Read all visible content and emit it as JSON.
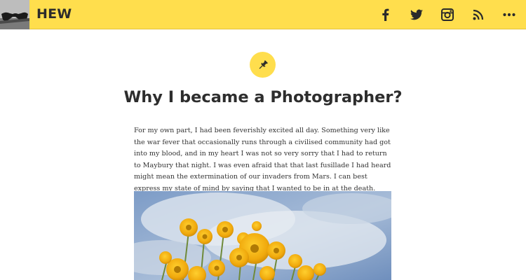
{
  "header": {
    "site_title": "HEW",
    "background_color": "#ffde4d",
    "logo_icon": "sunglasses-avatar-image",
    "social_icons": [
      "facebook-icon",
      "twitter-icon",
      "instagram-icon",
      "rss-icon",
      "more-icon"
    ]
  },
  "post": {
    "format_icon": "pushpin-icon",
    "title": "Why I became a Photographer?",
    "body": "For my own part, I had been feverishly excited all day. Something very like the war fever that occasionally runs through a civilised community had got into my blood, and in my heart I was not so very sorry that I had to return to Maybury that night. I was even afraid that that last fusillade I had heard might mean the extermination of our invaders from Mars. I can best express my state of mind by saying that I wanted to be in at the death.",
    "featured_image": "yellow-flowers-against-sky"
  }
}
